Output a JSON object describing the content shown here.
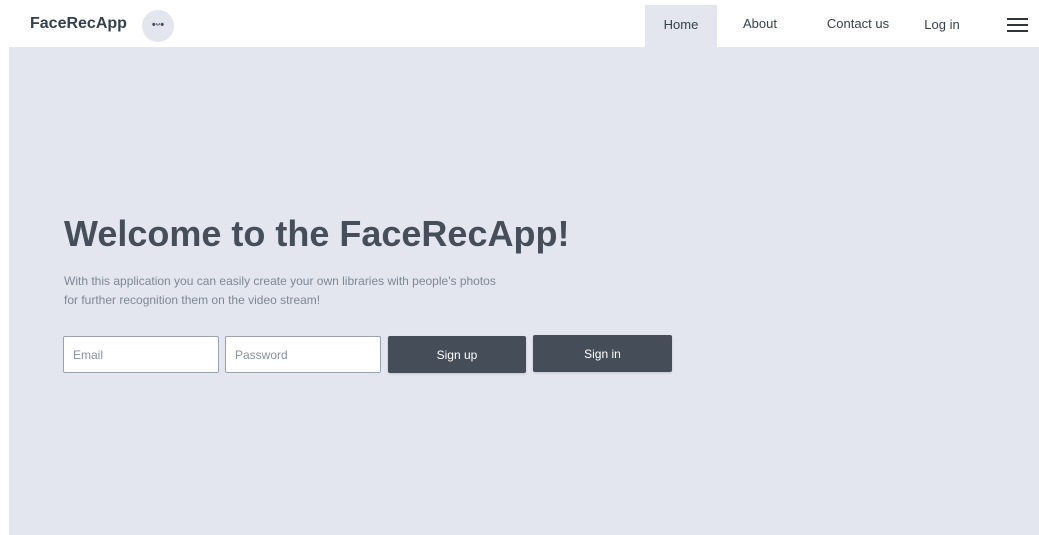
{
  "brand": {
    "name": "FaceRecApp",
    "logo_glyph": "•ᵕ•"
  },
  "nav": {
    "home": "Home",
    "about": "About",
    "contact": "Contact us",
    "login": "Log in",
    "active": "Home",
    "menu_icon": "hamburger-icon"
  },
  "hero": {
    "title": "Welcome to the FaceRecApp!",
    "description": "With this application you can easily create your own libraries with people's photos for further recognition them on the video stream!"
  },
  "form": {
    "email_placeholder": "Email",
    "email_value": "",
    "password_placeholder": "Password",
    "password_value": "",
    "signup_label": "Sign up",
    "signin_label": "Sign in"
  },
  "colors": {
    "hero_background": "#e3e6ef",
    "button_background": "#454e58",
    "text_primary": "#36404a",
    "text_muted": "#7e8793"
  }
}
